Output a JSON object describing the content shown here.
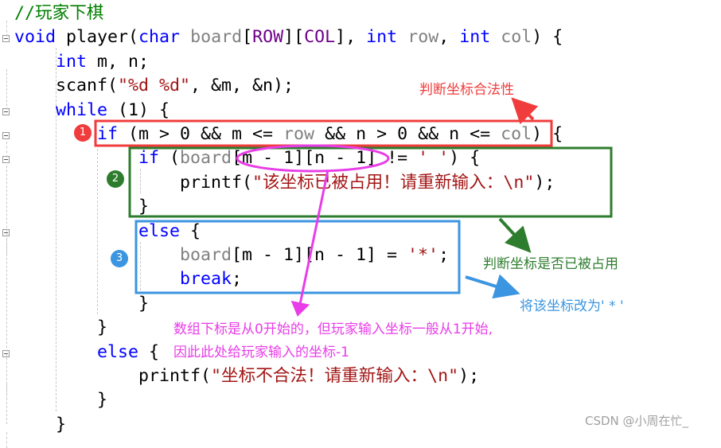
{
  "code_lines": [
    [
      [
        "//玩家下棋",
        "cm"
      ]
    ],
    [
      [
        "void",
        "kw"
      ],
      [
        " player(",
        "pl"
      ],
      [
        "char",
        "kw"
      ],
      [
        " ",
        "pl"
      ],
      [
        "board",
        "param"
      ],
      [
        "[",
        "pl"
      ],
      [
        "ROW",
        "macro"
      ],
      [
        "][",
        "pl"
      ],
      [
        "COL",
        "macro"
      ],
      [
        "], ",
        "pl"
      ],
      [
        "int",
        "kw"
      ],
      [
        " ",
        "pl"
      ],
      [
        "row",
        "param"
      ],
      [
        ", ",
        "pl"
      ],
      [
        "int",
        "kw"
      ],
      [
        " ",
        "pl"
      ],
      [
        "col",
        "param"
      ],
      [
        ") {",
        "pl"
      ]
    ],
    [
      [
        "    ",
        "pl"
      ],
      [
        "int",
        "kw"
      ],
      [
        " m, n;",
        "pl"
      ]
    ],
    [
      [
        "    scanf(",
        "pl"
      ],
      [
        "\"%d %d\"",
        "str"
      ],
      [
        ", &m, &n);",
        "pl"
      ]
    ],
    [
      [
        "    ",
        "pl"
      ],
      [
        "while",
        "kw"
      ],
      [
        " (1) {",
        "pl"
      ]
    ],
    [
      [
        "        ",
        "pl"
      ],
      [
        "if",
        "kw"
      ],
      [
        " (m > 0 && m <= ",
        "pl"
      ],
      [
        "row",
        "param"
      ],
      [
        " && n > 0 && n <= ",
        "pl"
      ],
      [
        "col",
        "param"
      ],
      [
        ") {",
        "pl"
      ]
    ],
    [
      [
        "            ",
        "pl"
      ],
      [
        "if",
        "kw"
      ],
      [
        " (",
        "pl"
      ],
      [
        "board",
        "param"
      ],
      [
        "[m - 1][n - 1] != ",
        "pl"
      ],
      [
        "' '",
        "str"
      ],
      [
        ") {",
        "pl"
      ]
    ],
    [
      [
        "                printf(",
        "pl"
      ],
      [
        "\"该坐标已被占用！请重新输入：\\n\"",
        "str"
      ],
      [
        ");",
        "pl"
      ]
    ],
    [
      [
        "            }",
        "pl"
      ]
    ],
    [
      [
        "            ",
        "pl"
      ],
      [
        "else",
        "kw"
      ],
      [
        " {",
        "pl"
      ]
    ],
    [
      [
        "                ",
        "pl"
      ],
      [
        "board",
        "param"
      ],
      [
        "[m - 1][n - 1] = ",
        "pl"
      ],
      [
        "'*'",
        "str"
      ],
      [
        ";",
        "pl"
      ]
    ],
    [
      [
        "                ",
        "pl"
      ],
      [
        "break",
        "kw"
      ],
      [
        ";",
        "pl"
      ]
    ],
    [
      [
        "            }",
        "pl"
      ]
    ],
    [
      [
        "        }",
        "pl"
      ]
    ],
    [
      [
        "        ",
        "pl"
      ],
      [
        "else",
        "kw"
      ],
      [
        " {",
        "pl"
      ]
    ],
    [
      [
        "            printf(",
        "pl"
      ],
      [
        "\"坐标不合法！请重新输入：\\n\"",
        "str"
      ],
      [
        ");",
        "pl"
      ]
    ],
    [
      [
        "        }",
        "pl"
      ]
    ],
    [
      [
        "    }",
        "pl"
      ]
    ]
  ],
  "annotations": {
    "badge1": "1",
    "badge2": "2",
    "badge3": "3",
    "legality": "判断坐标合法性",
    "occupied": "判断坐标是否已被占用",
    "set_star": "将该坐标改为' * '",
    "index_note_1": "数组下标是从0开始的，但玩家输入坐标一般从1开始,",
    "index_note_2": "因此此处给玩家输入的坐标-1"
  },
  "watermark": "CSDN @小周在忙_",
  "colors": {
    "red": "#f03c3c",
    "green": "#2e7d2e",
    "blue": "#3b95e0",
    "magenta": "#e83de8"
  }
}
